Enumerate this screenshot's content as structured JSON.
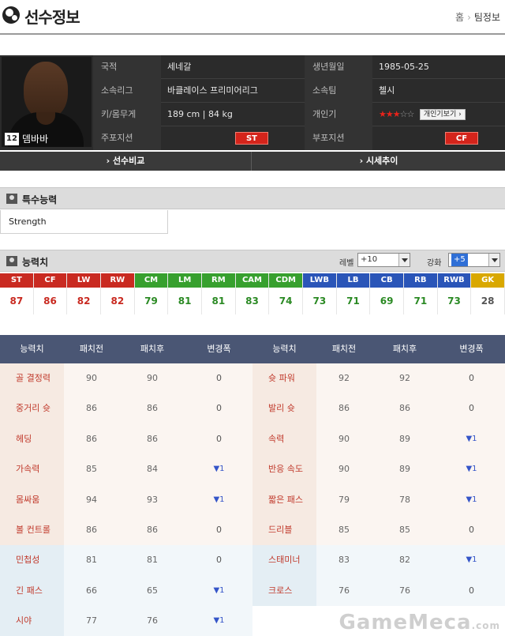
{
  "header": {
    "title": "선수정보",
    "breadcrumb": [
      "홈",
      "팀정보"
    ]
  },
  "player": {
    "number": "12",
    "name": "뎀바바",
    "info": [
      {
        "label": "국적",
        "value": "세네갈",
        "label2": "생년월일",
        "value2": "1985-05-25"
      },
      {
        "label": "소속리그",
        "value": "바클레이스 프리미어리그",
        "label2": "소속팀",
        "value2": "첼시"
      },
      {
        "label": "키/몸무게",
        "value": "189 cm | 84 kg",
        "label2": "개인기",
        "value2": ""
      },
      {
        "label": "주포지션",
        "value": "ST",
        "label2": "부포지션",
        "value2": "CF"
      }
    ],
    "skill_stars": {
      "filled": 3,
      "total": 5
    },
    "skill_button": "개인기보기 ›"
  },
  "tabs": [
    "› 선수비교",
    "› 시세추이"
  ],
  "special": {
    "title": "특수능력",
    "value": "Strength"
  },
  "ability": {
    "title": "능력치",
    "level_label": "레벨",
    "level_value": "+10",
    "enhance_label": "강화",
    "enhance_value": "+5"
  },
  "positions": [
    {
      "pos": "ST",
      "val": "87",
      "color": "red"
    },
    {
      "pos": "CF",
      "val": "86",
      "color": "red"
    },
    {
      "pos": "LW",
      "val": "82",
      "color": "red"
    },
    {
      "pos": "RW",
      "val": "82",
      "color": "red"
    },
    {
      "pos": "CM",
      "val": "79",
      "color": "green"
    },
    {
      "pos": "LM",
      "val": "81",
      "color": "green"
    },
    {
      "pos": "RM",
      "val": "81",
      "color": "green"
    },
    {
      "pos": "CAM",
      "val": "83",
      "color": "green"
    },
    {
      "pos": "CDM",
      "val": "74",
      "color": "green"
    },
    {
      "pos": "LWB",
      "val": "73",
      "color": "blue"
    },
    {
      "pos": "LB",
      "val": "71",
      "color": "blue"
    },
    {
      "pos": "CB",
      "val": "69",
      "color": "blue"
    },
    {
      "pos": "RB",
      "val": "71",
      "color": "blue"
    },
    {
      "pos": "RWB",
      "val": "73",
      "color": "blue"
    },
    {
      "pos": "GK",
      "val": "28",
      "color": "gold"
    }
  ],
  "stats_headers": [
    "능력치",
    "패치전",
    "패치후",
    "변경폭",
    "능력치",
    "패치전",
    "패치후",
    "변경폭"
  ],
  "stats_rows": [
    {
      "tone": "warm",
      "n1": "골 결정력",
      "b1": "90",
      "a1": "90",
      "d1": "0",
      "n2": "슛 파워",
      "b2": "92",
      "a2": "92",
      "d2": "0"
    },
    {
      "tone": "warm",
      "n1": "중거리 슛",
      "b1": "86",
      "a1": "86",
      "d1": "0",
      "n2": "발리 슛",
      "b2": "86",
      "a2": "86",
      "d2": "0"
    },
    {
      "tone": "warm",
      "n1": "헤딩",
      "b1": "86",
      "a1": "86",
      "d1": "0",
      "n2": "속력",
      "b2": "90",
      "a2": "89",
      "d2": "▼1"
    },
    {
      "tone": "warm",
      "n1": "가속력",
      "b1": "85",
      "a1": "84",
      "d1": "▼1",
      "n2": "반응 속도",
      "b2": "90",
      "a2": "89",
      "d2": "▼1"
    },
    {
      "tone": "warm",
      "n1": "몸싸움",
      "b1": "94",
      "a1": "93",
      "d1": "▼1",
      "n2": "짧은 패스",
      "b2": "79",
      "a2": "78",
      "d2": "▼1"
    },
    {
      "tone": "warm",
      "n1": "볼 컨트롤",
      "b1": "86",
      "a1": "86",
      "d1": "0",
      "n2": "드리블",
      "b2": "85",
      "a2": "85",
      "d2": "0"
    },
    {
      "tone": "cool",
      "n1": "민첩성",
      "b1": "81",
      "a1": "81",
      "d1": "0",
      "n2": "스태미너",
      "b2": "83",
      "a2": "82",
      "d2": "▼1"
    },
    {
      "tone": "cool",
      "n1": "긴 패스",
      "b1": "66",
      "a1": "65",
      "d1": "▼1",
      "n2": "크로스",
      "b2": "76",
      "a2": "76",
      "d2": "0"
    },
    {
      "tone": "cool",
      "n1": "시야",
      "b1": "77",
      "a1": "76",
      "d1": "▼1",
      "n2": "",
      "b2": "",
      "a2": "",
      "d2": ""
    }
  ],
  "watermark": {
    "main": "GameMeca",
    "suffix": ".com"
  }
}
